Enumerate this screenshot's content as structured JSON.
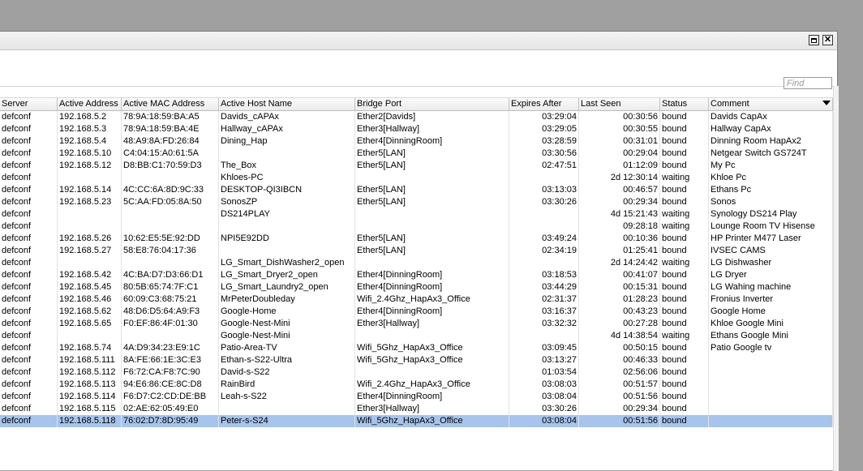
{
  "toolbar": {
    "find_placeholder": "Find"
  },
  "columns": [
    "Server",
    "Active Address",
    "Active MAC Address",
    "Active Host Name",
    "Bridge Port",
    "Expires After",
    "Last Seen",
    "Status",
    "Comment"
  ],
  "rows": [
    {
      "server": "defconf",
      "address": "192.168.5.2",
      "mac": "78:9A:18:59:BA:A5",
      "host": "Davids_cAPAx",
      "port": "Ether2[Davids]",
      "expires": "03:29:04",
      "seen": "00:30:56",
      "status": "bound",
      "comment": "Davids CapAx"
    },
    {
      "server": "defconf",
      "address": "192.168.5.3",
      "mac": "78:9A:18:59:BA:4E",
      "host": "Hallway_cAPAx",
      "port": "Ether3[Hallway]",
      "expires": "03:29:05",
      "seen": "00:30:55",
      "status": "bound",
      "comment": "Hallway CapAx"
    },
    {
      "server": "defconf",
      "address": "192.168.5.4",
      "mac": "48:A9:8A:FD:26:84",
      "host": "Dining_Hap",
      "port": "Ether4[DinningRoom]",
      "expires": "03:28:59",
      "seen": "00:31:01",
      "status": "bound",
      "comment": "Dinning Room HapAx2"
    },
    {
      "server": "defconf",
      "address": "192.168.5.10",
      "mac": "C4:04:15:A0:61:5A",
      "host": "",
      "port": "Ether5[LAN]",
      "expires": "03:30:56",
      "seen": "00:29:04",
      "status": "bound",
      "comment": "Netgear Switch GS724T"
    },
    {
      "server": "defconf",
      "address": "192.168.5.12",
      "mac": "D8:BB:C1:70:59:D3",
      "host": "The_Box",
      "port": "Ether5[LAN]",
      "expires": "02:47:51",
      "seen": "01:12:09",
      "status": "bound",
      "comment": "My Pc"
    },
    {
      "server": "defconf",
      "address": "",
      "mac": "",
      "host": "Khloes-PC",
      "port": "",
      "expires": "",
      "seen": "2d 12:30:14",
      "status": "waiting",
      "comment": "Khloe Pc"
    },
    {
      "server": "defconf",
      "address": "192.168.5.14",
      "mac": "4C:CC:6A:8D:9C:33",
      "host": "DESKTOP-QI3IBCN",
      "port": "Ether5[LAN]",
      "expires": "03:13:03",
      "seen": "00:46:57",
      "status": "bound",
      "comment": "Ethans Pc"
    },
    {
      "server": "defconf",
      "address": "192.168.5.23",
      "mac": "5C:AA:FD:05:8A:50",
      "host": "SonosZP",
      "port": "Ether5[LAN]",
      "expires": "03:30:26",
      "seen": "00:29:34",
      "status": "bound",
      "comment": "Sonos"
    },
    {
      "server": "defconf",
      "address": "",
      "mac": "",
      "host": "DS214PLAY",
      "port": "",
      "expires": "",
      "seen": "4d 15:21:43",
      "status": "waiting",
      "comment": "Synology DS214 Play"
    },
    {
      "server": "defconf",
      "address": "",
      "mac": "",
      "host": "",
      "port": "",
      "expires": "",
      "seen": "09:28:18",
      "status": "waiting",
      "comment": "Lounge Room TV Hisense"
    },
    {
      "server": "defconf",
      "address": "192.168.5.26",
      "mac": "10:62:E5:5E:92:DD",
      "host": "NPI5E92DD",
      "port": "Ether5[LAN]",
      "expires": "03:49:24",
      "seen": "00:10:36",
      "status": "bound",
      "comment": "HP Printer M477 Laser"
    },
    {
      "server": "defconf",
      "address": "192.168.5.27",
      "mac": "58:E8:76:04:17:36",
      "host": "",
      "port": "Ether5[LAN]",
      "expires": "02:34:19",
      "seen": "01:25:41",
      "status": "bound",
      "comment": "IVSEC CAMS"
    },
    {
      "server": "defconf",
      "address": "",
      "mac": "",
      "host": "LG_Smart_DishWasher2_open",
      "port": "",
      "expires": "",
      "seen": "2d 14:24:42",
      "status": "waiting",
      "comment": "LG Dishwasher"
    },
    {
      "server": "defconf",
      "address": "192.168.5.42",
      "mac": "4C:BA:D7:D3:66:D1",
      "host": "LG_Smart_Dryer2_open",
      "port": "Ether4[DinningRoom]",
      "expires": "03:18:53",
      "seen": "00:41:07",
      "status": "bound",
      "comment": "LG Dryer"
    },
    {
      "server": "defconf",
      "address": "192.168.5.45",
      "mac": "80:5B:65:74:7F:C1",
      "host": "LG_Smart_Laundry2_open",
      "port": "Ether4[DinningRoom]",
      "expires": "03:44:29",
      "seen": "00:15:31",
      "status": "bound",
      "comment": "LG Wahing machine"
    },
    {
      "server": "defconf",
      "address": "192.168.5.46",
      "mac": "60:09:C3:68:75:21",
      "host": "MrPeterDoubleday",
      "port": "Wifi_2.4Ghz_HapAx3_Office",
      "expires": "02:31:37",
      "seen": "01:28:23",
      "status": "bound",
      "comment": "Fronius Inverter"
    },
    {
      "server": "defconf",
      "address": "192.168.5.62",
      "mac": "48:D6:D5:64:A9:F3",
      "host": "Google-Home",
      "port": "Ether4[DinningRoom]",
      "expires": "03:16:37",
      "seen": "00:43:23",
      "status": "bound",
      "comment": "Google Home"
    },
    {
      "server": "defconf",
      "address": "192.168.5.65",
      "mac": "F0:EF:86:4F:01:30",
      "host": "Google-Nest-Mini",
      "port": "Ether3[Hallway]",
      "expires": "03:32:32",
      "seen": "00:27:28",
      "status": "bound",
      "comment": "Khloe Google Mini"
    },
    {
      "server": "defconf",
      "address": "",
      "mac": "",
      "host": "Google-Nest-Mini",
      "port": "",
      "expires": "",
      "seen": "4d 14:38:54",
      "status": "waiting",
      "comment": "Ethans Google Mini"
    },
    {
      "server": "defconf",
      "address": "192.168.5.74",
      "mac": "4A:D9:34:23:E9:1C",
      "host": "Patio-Area-TV",
      "port": "Wifi_5Ghz_HapAx3_Office",
      "expires": "03:09:45",
      "seen": "00:50:15",
      "status": "bound",
      "comment": "Patio Google tv"
    },
    {
      "server": "defconf",
      "address": "192.168.5.111",
      "mac": "8A:FE:66:1E:3C:E3",
      "host": "Ethan-s-S22-Ultra",
      "port": "Wifi_5Ghz_HapAx3_Office",
      "expires": "03:13:27",
      "seen": "00:46:33",
      "status": "bound",
      "comment": ""
    },
    {
      "server": "defconf",
      "address": "192.168.5.112",
      "mac": "F6:72:CA:F8:7C:90",
      "host": "David-s-S22",
      "port": "",
      "expires": "01:03:54",
      "seen": "02:56:06",
      "status": "bound",
      "comment": ""
    },
    {
      "server": "defconf",
      "address": "192.168.5.113",
      "mac": "94:E6:86:CE:8C:D8",
      "host": "RainBird",
      "port": "Wifi_2.4Ghz_HapAx3_Office",
      "expires": "03:08:03",
      "seen": "00:51:57",
      "status": "bound",
      "comment": ""
    },
    {
      "server": "defconf",
      "address": "192.168.5.114",
      "mac": "F6:D7:C2:CD:DE:BB",
      "host": "Leah-s-S22",
      "port": "Ether4[DinningRoom]",
      "expires": "03:08:04",
      "seen": "00:51:56",
      "status": "bound",
      "comment": ""
    },
    {
      "server": "defconf",
      "address": "192.168.5.115",
      "mac": "02:AE:62:05:49:E0",
      "host": "",
      "port": "Ether3[Hallway]",
      "expires": "03:30:26",
      "seen": "00:29:34",
      "status": "bound",
      "comment": ""
    },
    {
      "server": "defconf",
      "address": "192.168.5.118",
      "mac": "76:02:D7:8D:95:49",
      "host": "Peter-s-S24",
      "port": "Wifi_5Ghz_HapAx3_Office",
      "expires": "03:08:04",
      "seen": "00:51:56",
      "status": "bound",
      "comment": "",
      "selected": true
    }
  ]
}
